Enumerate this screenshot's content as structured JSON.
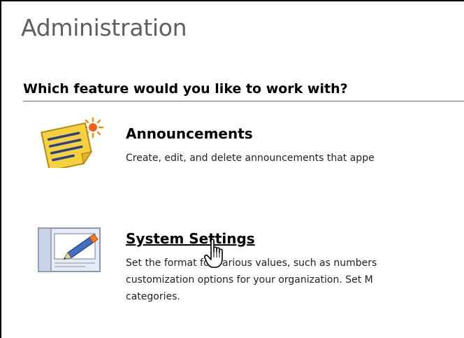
{
  "page": {
    "title": "Administration"
  },
  "section": {
    "question": "Which feature would you like to work with?"
  },
  "features": [
    {
      "title": "Announcements",
      "description": "Create, edit, and delete announcements that appe",
      "icon": "sticky-note-icon"
    },
    {
      "title": "System Settings",
      "description_lines": [
        "Set the format for various values, such as numbers",
        "customization options for your organization. Set M",
        "categories."
      ],
      "icon": "system-settings-icon"
    }
  ],
  "cursor": {
    "icon": "hand-pointer-icon"
  },
  "colors": {
    "note_yellow": "#f5d23c",
    "note_lines": "#2b3f8f",
    "title_gray": "#5f5f5f"
  }
}
